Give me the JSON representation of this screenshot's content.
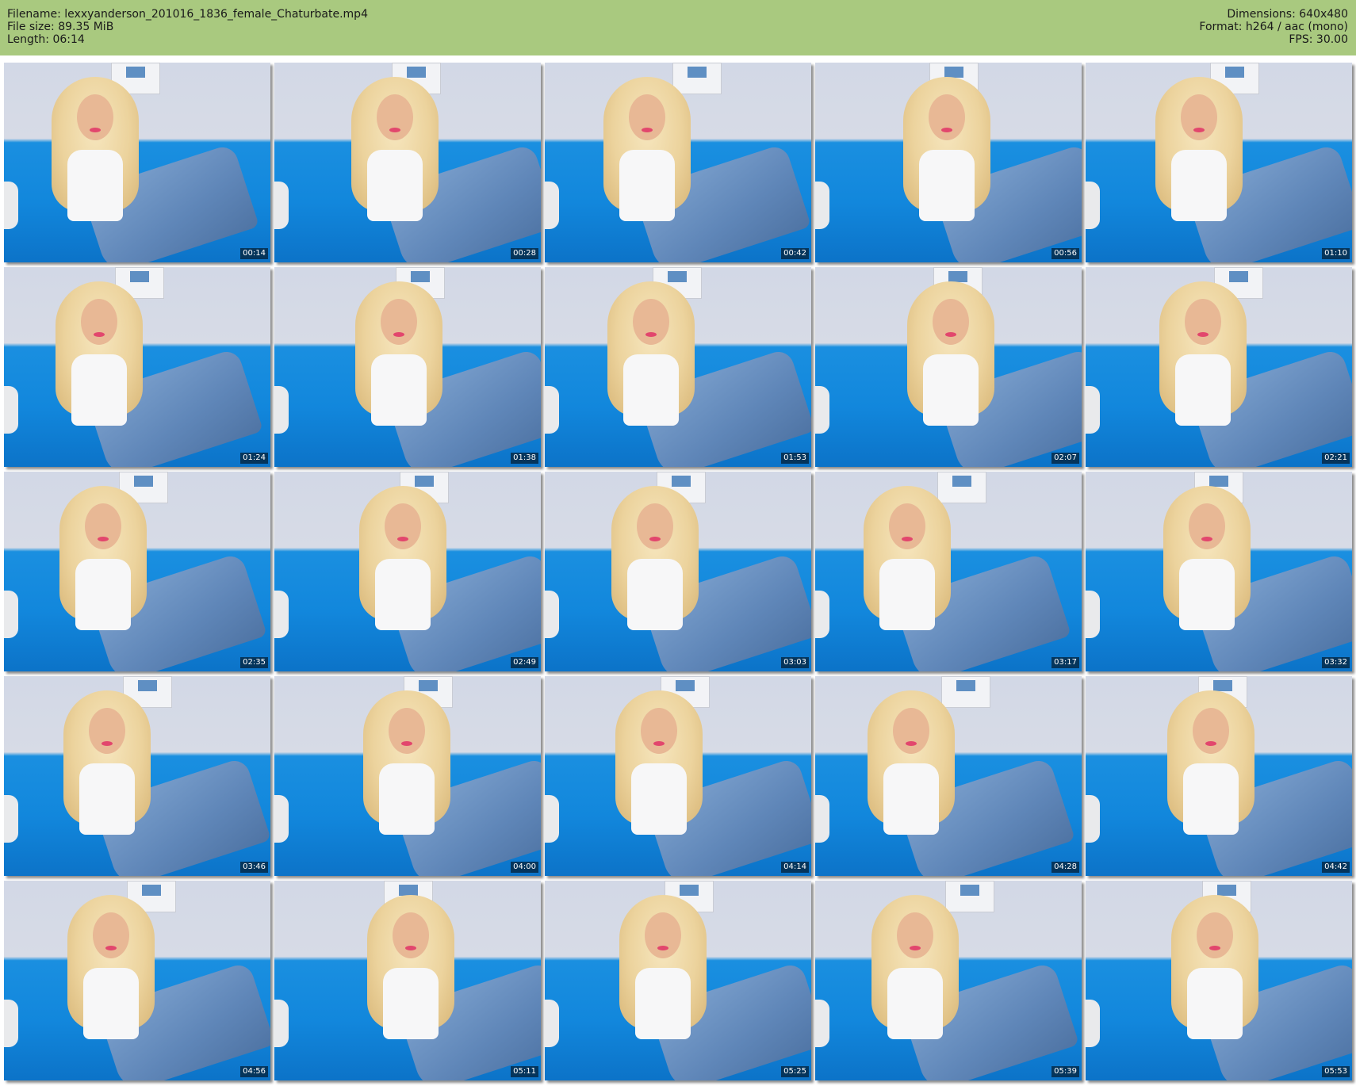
{
  "header": {
    "filename_line": "Filename: lexxyanderson_201016_1836_female_Chaturbate.mp4",
    "filesize_line": "File size: 89.35 MiB",
    "length_line": "Length: 06:14",
    "dimensions_line": "Dimensions: 640x480",
    "format_line": "Format: h264 / aac (mono)",
    "fps_line": "FPS: 30.00",
    "background_color": "#a9c97f"
  },
  "thumbnails": [
    {
      "timestamp": "00:14"
    },
    {
      "timestamp": "00:28"
    },
    {
      "timestamp": "00:42"
    },
    {
      "timestamp": "00:56"
    },
    {
      "timestamp": "01:10"
    },
    {
      "timestamp": "01:24"
    },
    {
      "timestamp": "01:38"
    },
    {
      "timestamp": "01:53"
    },
    {
      "timestamp": "02:07"
    },
    {
      "timestamp": "02:21"
    },
    {
      "timestamp": "02:35"
    },
    {
      "timestamp": "02:49"
    },
    {
      "timestamp": "03:03"
    },
    {
      "timestamp": "03:17"
    },
    {
      "timestamp": "03:32"
    },
    {
      "timestamp": "03:46"
    },
    {
      "timestamp": "04:00"
    },
    {
      "timestamp": "04:14"
    },
    {
      "timestamp": "04:28"
    },
    {
      "timestamp": "04:42"
    },
    {
      "timestamp": "04:56"
    },
    {
      "timestamp": "05:11"
    },
    {
      "timestamp": "05:25"
    },
    {
      "timestamp": "05:39"
    },
    {
      "timestamp": "05:53"
    }
  ]
}
